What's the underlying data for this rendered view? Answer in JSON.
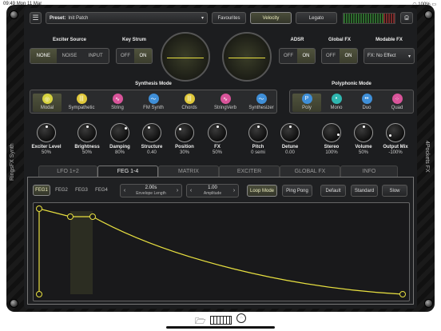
{
  "status": {
    "time": "09:49",
    "date": "Mon 11 Mar",
    "battery": "100%"
  },
  "side_labels": {
    "left": "RingsFX Synth",
    "right": "4Pockets FX"
  },
  "topbar": {
    "menu_icon": "hamburger-icon",
    "preset_label": "Preset:",
    "preset_value": "Init Patch",
    "favourites": "Favourites",
    "velocity": "Velocity",
    "legato": "Legato"
  },
  "exciter_source": {
    "title": "Exciter Source",
    "options": [
      "NONE",
      "NOISE",
      "INPUT"
    ],
    "selected": "NONE"
  },
  "key_strum": {
    "title": "Key Strum",
    "options": [
      "OFF",
      "ON"
    ],
    "selected": "ON"
  },
  "adsr": {
    "title": "ADSR",
    "options": [
      "OFF",
      "ON"
    ],
    "selected": "ON"
  },
  "global_fx": {
    "title": "Global FX",
    "options": [
      "OFF",
      "ON"
    ],
    "selected": "ON"
  },
  "modable_fx": {
    "title": "Modable FX",
    "value": "FX: No Effect"
  },
  "synthesis_mode": {
    "title": "Synthesis Mode",
    "modes": [
      {
        "label": "Modal",
        "icon": "modal-icon",
        "color": "#d7d340"
      },
      {
        "label": "Sympathetic",
        "icon": "sympathetic-icon",
        "color": "#e0c83a"
      },
      {
        "label": "String",
        "icon": "string-icon",
        "color": "#d9549a"
      },
      {
        "label": "FM Synth",
        "icon": "fm-synth-icon",
        "color": "#3f8fd8"
      },
      {
        "label": "Chords",
        "icon": "chords-icon",
        "color": "#e0c83a"
      },
      {
        "label": "StringVerb",
        "icon": "stringverb-icon",
        "color": "#d9549a"
      },
      {
        "label": "Synthesizer",
        "icon": "synthesizer-icon",
        "color": "#3f8fd8"
      }
    ],
    "selected": "Modal"
  },
  "polyphonic_mode": {
    "title": "Polyphonic Mode",
    "modes": [
      {
        "label": "Poly",
        "icon": "P",
        "color": "#3f8fd8"
      },
      {
        "label": "Mono",
        "icon": "•",
        "color": "#2fb6b0"
      },
      {
        "label": "Duo",
        "icon": "••",
        "color": "#3f8fd8"
      },
      {
        "label": "Quad",
        "icon": "⁘",
        "color": "#d9549a"
      }
    ],
    "selected": "Poly"
  },
  "knobs": [
    {
      "label": "Exciter Level",
      "value": "50%"
    },
    {
      "label": "Brightness",
      "value": "50%"
    },
    {
      "label": "Damping",
      "value": "80%"
    },
    {
      "label": "Structure",
      "value": "0.40"
    },
    {
      "label": "Position",
      "value": "30%"
    },
    {
      "label": "FX",
      "value": "50%"
    },
    {
      "label": "Pitch",
      "value": "0 semi"
    },
    {
      "label": "Detune",
      "value": "0.00"
    },
    {
      "label": "Stereo",
      "value": "100%"
    },
    {
      "label": "Volume",
      "value": "50%"
    },
    {
      "label": "Output Mix",
      "value": "-100%"
    }
  ],
  "tabs": [
    "LFO 1+2",
    "FEG 1-4",
    "MATRIX",
    "EXCITER",
    "GLOBAL FX",
    "INFO"
  ],
  "selected_tab": "FEG 1-4",
  "feg": {
    "selectors": [
      "FEG1",
      "FEG2",
      "FEG3",
      "FEG4"
    ],
    "selected": "FEG1",
    "envelope_length": {
      "value": "2.00s",
      "label": "Envelope Length"
    },
    "amplitude": {
      "value": "1.00",
      "label": "Amplitude"
    },
    "loop_mode": "Loop Mode",
    "ping_pong": "Ping Pong",
    "default": "Default",
    "standard": "Standard",
    "slow": "Slow"
  },
  "bottom_icons": [
    "folder-icon",
    "keyboard-icon",
    "midi-icon"
  ]
}
